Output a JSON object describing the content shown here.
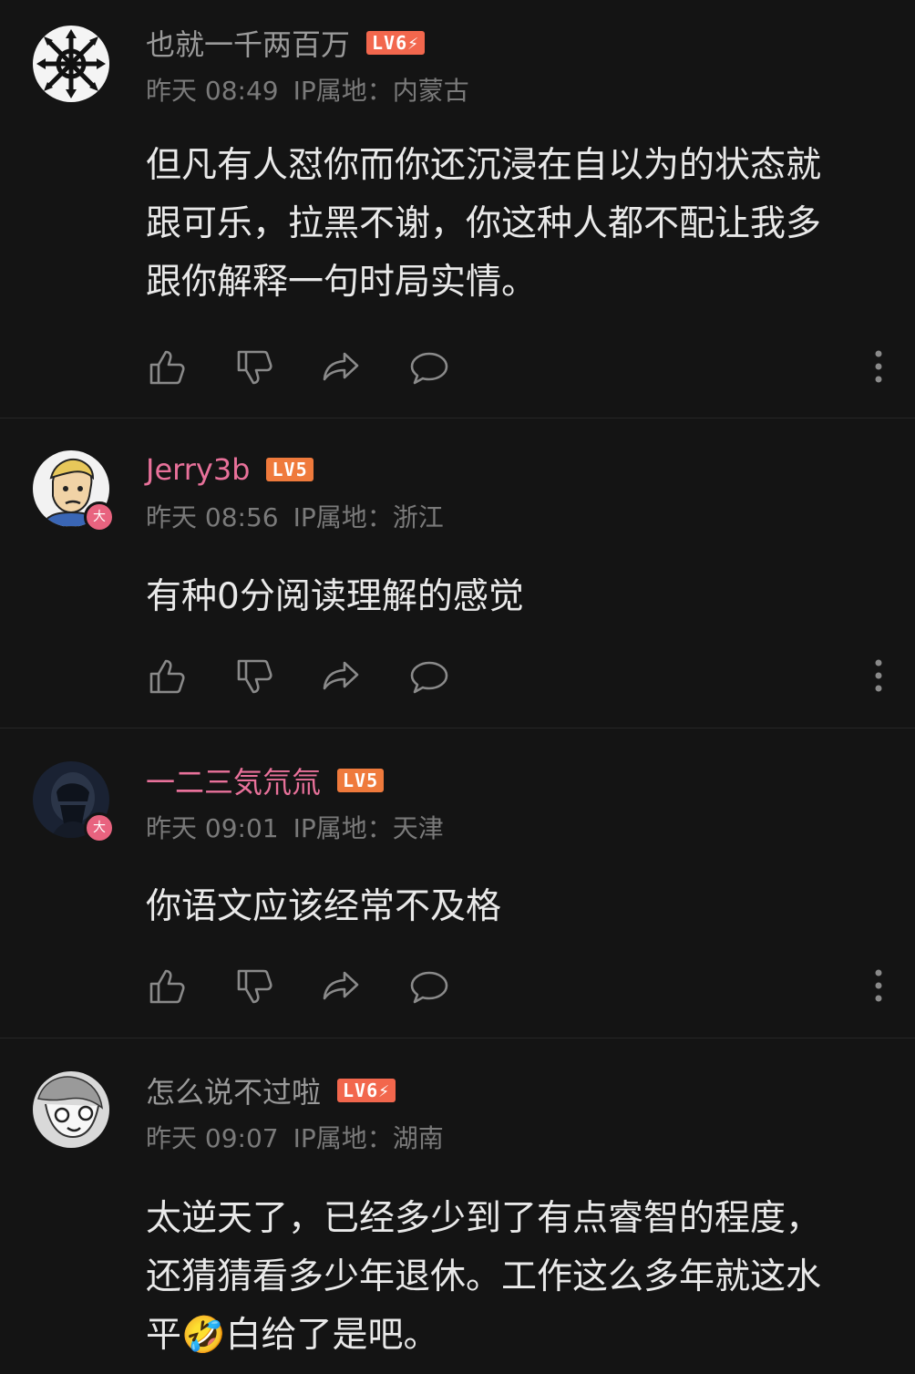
{
  "comments": [
    {
      "username": "也就一千两百万",
      "level": "LV6⚡",
      "time": "昨天 08:49",
      "ip": "IP属地：内蒙古",
      "text": [
        "但凡有人怼你而你还沉浸在自以为的状态就",
        "跟可乐，拉黑不谢，你这种人都不配让我多",
        "跟你解释一句时局实情。"
      ]
    },
    {
      "username": "Jerry3b",
      "level": "LV5",
      "time": "昨天 08:56",
      "ip": "IP属地：浙江",
      "badge": "大",
      "text": [
        "有种0分阅读理解的感觉"
      ]
    },
    {
      "username": "一二三気氘氚",
      "level": "LV5",
      "time": "昨天 09:01",
      "ip": "IP属地：天津",
      "badge": "大",
      "text": [
        "你语文应该经常不及格"
      ]
    },
    {
      "username": "怎么说不过啦",
      "level": "LV6⚡",
      "time": "昨天 09:07",
      "ip": "IP属地：湖南",
      "text": [
        "太逆天了，已经多少到了有点睿智的程度，",
        "还猜猜看多少年退休。工作这么多年就这水",
        "平🤣白给了是吧。"
      ]
    }
  ],
  "icons": [
    "thumb-up-icon",
    "thumb-down-icon",
    "share-icon",
    "reply-icon",
    "more-icon"
  ],
  "colors": {
    "background": "#141414",
    "level_badge": "#f2674d",
    "vip_name": "#e8719a"
  }
}
